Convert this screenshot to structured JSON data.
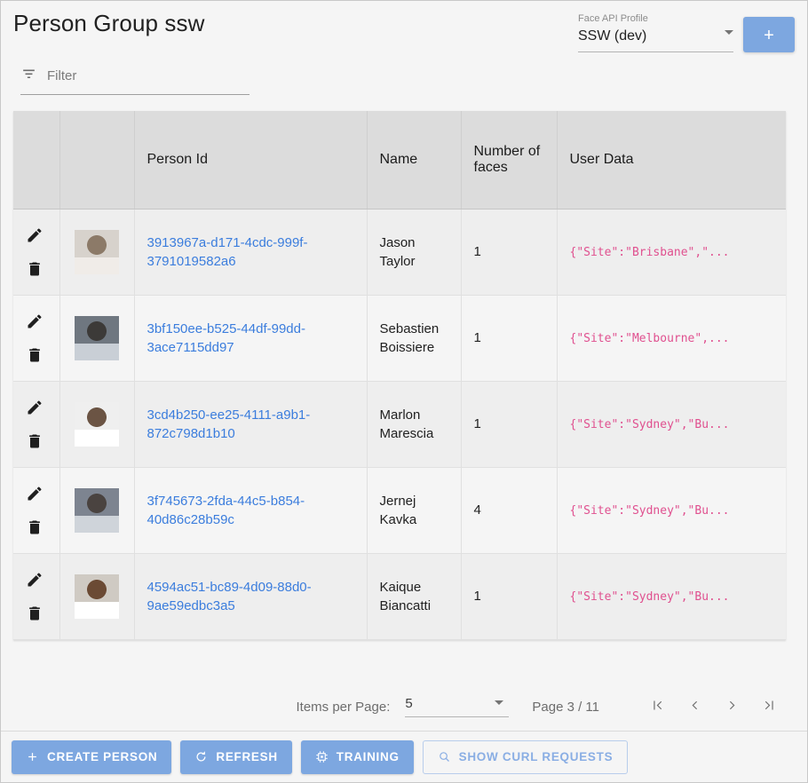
{
  "header": {
    "title": "Person Group ssw",
    "profile": {
      "label": "Face API Profile",
      "value": "SSW (dev)"
    },
    "add_button_label": "+"
  },
  "filter": {
    "placeholder": "Filter",
    "value": "",
    "icon": "filter-list-icon"
  },
  "table": {
    "columns": [
      {
        "key": "actions",
        "label": ""
      },
      {
        "key": "avatar",
        "label": ""
      },
      {
        "key": "person_id",
        "label": "Person Id"
      },
      {
        "key": "name",
        "label": "Name"
      },
      {
        "key": "faces",
        "label": "Number of faces"
      },
      {
        "key": "user_data",
        "label": "User Data"
      }
    ],
    "rows": [
      {
        "person_id": "3913967a-d171-4cdc-999f-3791019582a6",
        "name": "Jason Taylor",
        "faces": "1",
        "user_data": "{\"Site\":\"Brisbane\",\"...",
        "edit_label": "edit-icon",
        "delete_label": "delete-icon"
      },
      {
        "person_id": "3bf150ee-b525-44df-99dd-3ace7115dd97",
        "name": "Sebastien Boissiere",
        "faces": "1",
        "user_data": "{\"Site\":\"Melbourne\",...",
        "edit_label": "edit-icon",
        "delete_label": "delete-icon"
      },
      {
        "person_id": "3cd4b250-ee25-4111-a9b1-872c798d1b10",
        "name": "Marlon Marescia",
        "faces": "1",
        "user_data": "{\"Site\":\"Sydney\",\"Bu...",
        "edit_label": "edit-icon",
        "delete_label": "delete-icon"
      },
      {
        "person_id": "3f745673-2fda-44c5-b854-40d86c28b59c",
        "name": "Jernej Kavka",
        "faces": "4",
        "user_data": "{\"Site\":\"Sydney\",\"Bu...",
        "edit_label": "edit-icon",
        "delete_label": "delete-icon"
      },
      {
        "person_id": "4594ac51-bc89-4d09-88d0-9ae59edbc3a5",
        "name": "Kaique Biancatti",
        "faces": "1",
        "user_data": "{\"Site\":\"Sydney\",\"Bu...",
        "edit_label": "edit-icon",
        "delete_label": "delete-icon"
      }
    ]
  },
  "paginator": {
    "items_per_page_label": "Items per Page:",
    "items_per_page_value": "5",
    "page_label": "Page 3 / 11",
    "first_page": "first-page-icon",
    "prev_page": "previous-page-icon",
    "next_page": "next-page-icon",
    "last_page": "last-page-icon"
  },
  "toolbar": {
    "create_person": "CREATE PERSON",
    "refresh": "REFRESH",
    "training": "TRAINING",
    "show_curl": "SHOW CURL REQUESTS"
  },
  "colors": {
    "accent": "#7da7e0",
    "link": "#3b7ddd",
    "user_data": "#e0508f",
    "header_bg": "#dcdcdc",
    "page_bg": "#f5f5f5"
  }
}
